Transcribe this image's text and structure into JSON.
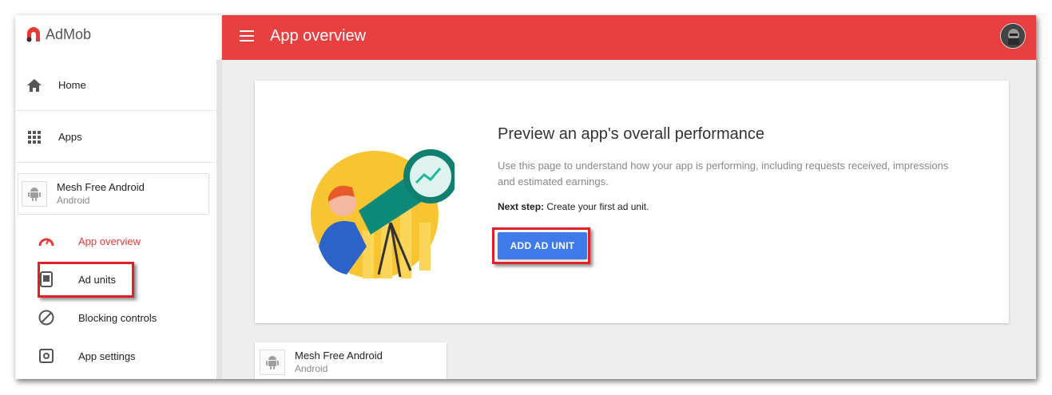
{
  "brand": {
    "name": "AdMob"
  },
  "topbar": {
    "title": "App overview"
  },
  "sidebar": {
    "nav": [
      {
        "label": "Home",
        "icon": "home-icon"
      },
      {
        "label": "Apps",
        "icon": "apps-grid-icon"
      }
    ],
    "app": {
      "name": "Mesh Free Android",
      "platform": "Android"
    },
    "sub_items": [
      {
        "label": "App overview",
        "icon": "gauge-icon",
        "active": true
      },
      {
        "label": "Ad units",
        "icon": "ad-unit-icon"
      },
      {
        "label": "Blocking controls",
        "icon": "block-icon"
      },
      {
        "label": "App settings",
        "icon": "settings-icon"
      }
    ]
  },
  "main": {
    "headline": "Preview an app's overall performance",
    "description": "Use this page to understand how your app is performing, including requests received, impressions and estimated earnings.",
    "next_step_label": "Next step:",
    "next_step_text": " Create your first ad unit.",
    "cta_label": "ADD AD UNIT"
  },
  "bottom_card": {
    "name": "Mesh Free Android",
    "platform": "Android"
  },
  "colors": {
    "accent": "#e84040",
    "primary_button": "#3f7be8",
    "highlight": "#e01f26"
  }
}
